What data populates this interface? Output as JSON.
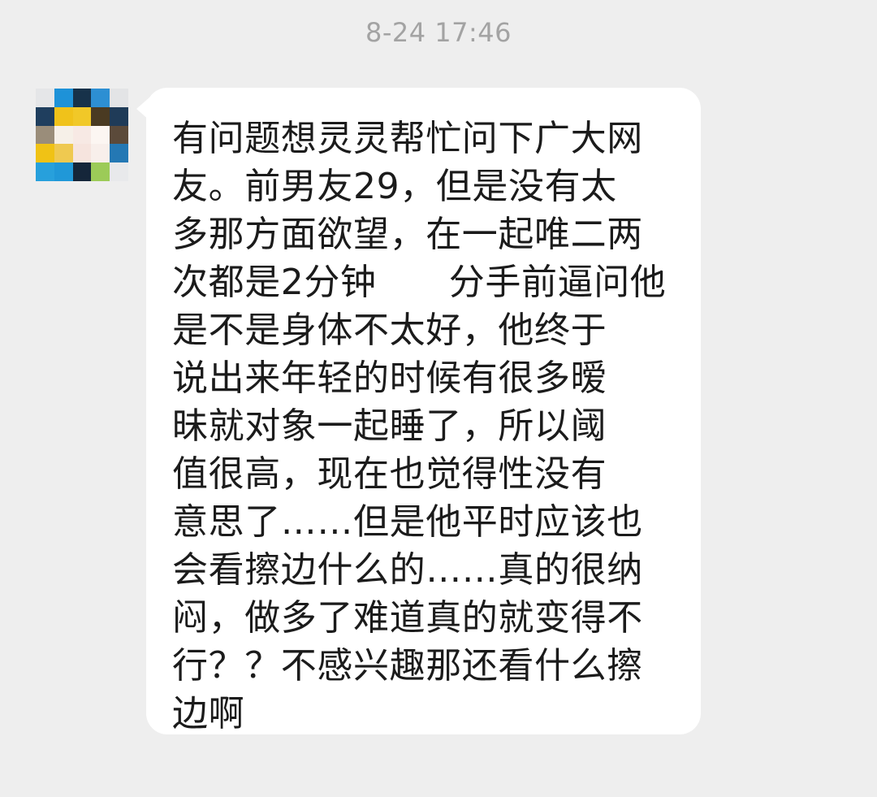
{
  "chat": {
    "timestamp": "8-24 17:46",
    "message": {
      "sender_avatar": "pixelated-avatar",
      "lines": [
        "有问题想灵灵帮忙问下广大网",
        "友。前男友29，但是没有太",
        "多那方面欲望，在一起唯二两",
        "次都是2分钟　　分手前逼问他",
        "是不是身体不太好，他终于",
        "说出来年轻的时候有很多暧",
        "昧就对象一起睡了，所以阈",
        "值很高，现在也觉得性没有",
        "意思了……但是他平时应该也",
        "会看擦边什么的……真的很纳",
        "闷，做多了难道真的就变得不",
        "行？？不感兴趣那还看什么擦",
        "边啊"
      ]
    },
    "colors": {
      "background": "#eeeeee",
      "bubble": "#ffffff",
      "text": "#1b1b1b",
      "timestamp": "#a3a3a3"
    },
    "avatar_pixels": [
      "#e5e6e8",
      "#1e92d8",
      "#17324a",
      "#2d8fd3",
      "#e3e4e6",
      "#1f3e5e",
      "#f0c21a",
      "#f1c828",
      "#4a3a22",
      "#1f3b58",
      "#9a8d7a",
      "#f6f0e8",
      "#f7e9e4",
      "#fcf6f2",
      "#5b4a3a",
      "#f0c215",
      "#efc950",
      "#f6e4de",
      "#f8efeb",
      "#2478b4",
      "#27a0dc",
      "#2098d8",
      "#15263a",
      "#9ccb58",
      "#e8e9eb"
    ]
  }
}
